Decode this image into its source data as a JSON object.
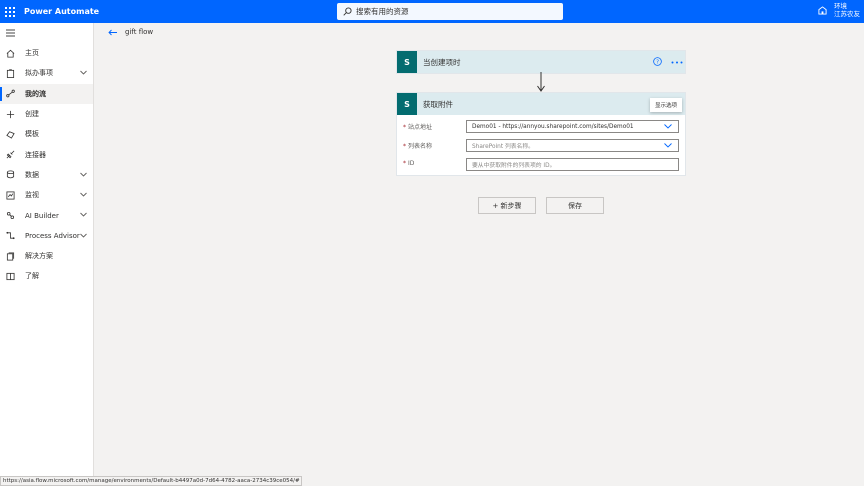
{
  "header": {
    "app_title": "Power Automate",
    "search_placeholder": "搜索有用的资源",
    "env_label": "环境",
    "env_name": "江苏农友"
  },
  "sidebar": {
    "items": [
      {
        "label": "主页",
        "icon": "home-icon",
        "chevron": false
      },
      {
        "label": "拟办事项",
        "icon": "clipboard-icon",
        "chevron": true
      },
      {
        "label": "我的流",
        "icon": "flow-icon",
        "chevron": false,
        "active": true
      },
      {
        "label": "创建",
        "icon": "plus-icon",
        "chevron": false
      },
      {
        "label": "模板",
        "icon": "template-icon",
        "chevron": false
      },
      {
        "label": "连接器",
        "icon": "connector-icon",
        "chevron": false
      },
      {
        "label": "数据",
        "icon": "database-icon",
        "chevron": true
      },
      {
        "label": "监视",
        "icon": "monitor-icon",
        "chevron": true
      },
      {
        "label": "AI Builder",
        "icon": "ai-builder-icon",
        "chevron": true
      },
      {
        "label": "Process Advisor",
        "icon": "process-advisor-icon",
        "chevron": true
      },
      {
        "label": "解决方案",
        "icon": "solutions-icon",
        "chevron": false
      },
      {
        "label": "了解",
        "icon": "book-icon",
        "chevron": false
      }
    ]
  },
  "breadcrumb": {
    "flow_name": "gift flow"
  },
  "trigger_card": {
    "logo_text": "S",
    "title": "当创建项时"
  },
  "action_card": {
    "logo_text": "S",
    "title": "获取附件",
    "tooltip": "显示选项",
    "fields": [
      {
        "label": "站点地址",
        "value": "Demo01 - https://annyou.sharepoint.com/sites/Demo01",
        "placeholder": false,
        "dropdown": true
      },
      {
        "label": "列表名称",
        "value": "SharePoint 列表名称。",
        "placeholder": true,
        "dropdown": true
      },
      {
        "label": "ID",
        "value": "要从中获取附件的列表项的 ID。",
        "placeholder": true,
        "dropdown": false
      }
    ]
  },
  "buttons": {
    "new_step": "+ 新步骤",
    "save": "保存"
  },
  "status_url": "https://asia.flow.microsoft.com/manage/environments/Default-b4497a0d-7d64-4782-aaca-2734c39ce054/#",
  "colors": {
    "brand_blue": "#0066ff",
    "sharepoint_teal": "#036c70",
    "card_header": "#dcebef"
  }
}
